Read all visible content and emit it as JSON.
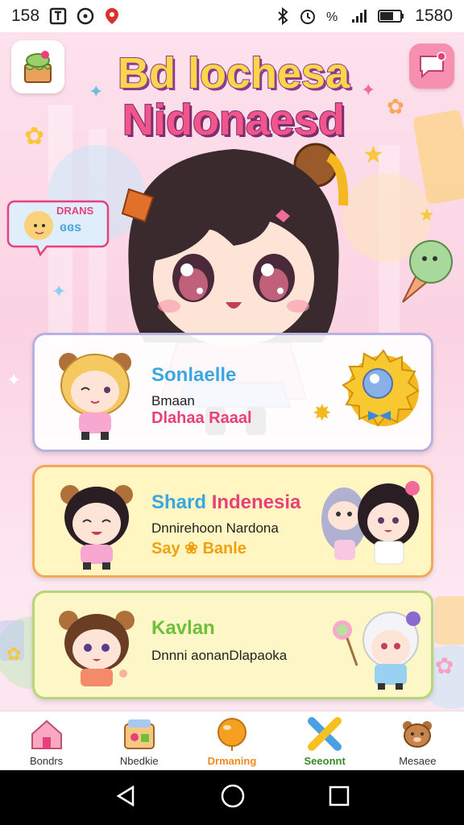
{
  "status_bar": {
    "time": "158",
    "clock": "1580"
  },
  "header": {
    "title_line1": "Bd lochesa",
    "title_line2": "Nidonaesd",
    "sticker_text1": "DRANS",
    "sticker_text2": "ɞɞs"
  },
  "cards": [
    {
      "title": "Sonlaelle",
      "line1": "Bmaan",
      "line2": "Dlahaa Raaal",
      "title_color": "#3aa7e0",
      "line2_color": "#e8407a"
    },
    {
      "title_part1": "Shard",
      "title_part2": "Indenesia",
      "line1": "Dnnirehoon Nardona",
      "line2": "Say ❀ Banle",
      "title_color1": "#3aa7e0",
      "title_color2": "#e8407a",
      "line2_color": "#f0a010"
    },
    {
      "title": "Kavlan",
      "line1": "Dnnni aonanDlapaoka",
      "title_color": "#6fbf3a"
    }
  ],
  "bottom_nav": [
    {
      "label": "Bondrs",
      "icon": "house-icon",
      "active": false
    },
    {
      "label": "Nbedkie",
      "icon": "toy-box-icon",
      "active": false
    },
    {
      "label": "Drmaning",
      "icon": "balloon-icon",
      "active": true
    },
    {
      "label": "Seeonnt",
      "icon": "crayon-icon",
      "active": false
    },
    {
      "label": "Mesaee",
      "icon": "bear-icon",
      "active": false
    }
  ],
  "colors": {
    "accent": "#f08a1c",
    "background": "#fde3ee"
  }
}
